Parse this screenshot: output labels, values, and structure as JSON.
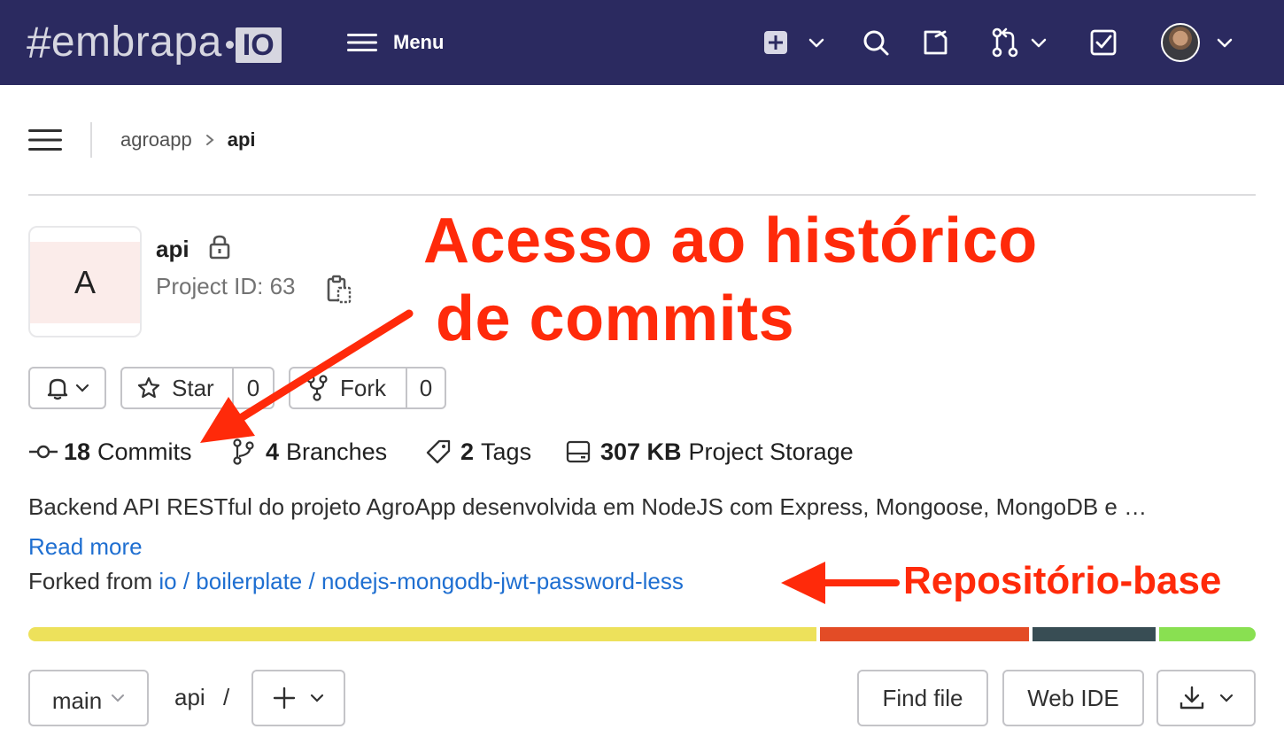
{
  "topbar": {
    "logo_hash": "#",
    "logo_word": "embrapa",
    "logo_io": "IO",
    "menu_label": "Menu",
    "bg_color": "#2b2a60"
  },
  "breadcrumb": {
    "group": "agroapp",
    "project": "api"
  },
  "project": {
    "avatar_letter": "A",
    "name": "api",
    "id_text": "Project ID: 63"
  },
  "actions": {
    "star_label": "Star",
    "star_count": "0",
    "fork_label": "Fork",
    "fork_count": "0"
  },
  "stats": {
    "commits_count": "18",
    "commits_label": "Commits",
    "branches_count": "4",
    "branches_label": "Branches",
    "tags_count": "2",
    "tags_label": "Tags",
    "storage_size": "307 KB",
    "storage_label": "Project Storage"
  },
  "description": "Backend API RESTful do projeto AgroApp desenvolvida em NodeJS com Express, Mongoose, MongoDB e …",
  "read_more": "Read more",
  "forked": {
    "prefix": "Forked from",
    "link": "io / boilerplate / nodejs-mongodb-jwt-password-less"
  },
  "languages": [
    {
      "color": "#ede15b",
      "fraction": 0.648
    },
    {
      "color": "#e34c26",
      "fraction": 0.172
    },
    {
      "color": "#384d54",
      "fraction": 0.101
    },
    {
      "color": "#89e051",
      "fraction": 0.073
    }
  ],
  "toolbar": {
    "branch": "main",
    "path_root": "api",
    "path_sep": "/",
    "find_file": "Find file",
    "web_ide": "Web IDE"
  },
  "annotations": {
    "commits_line1": "Acesso ao histórico",
    "commits_line2": "de commits",
    "fork_note": "Repositório-base",
    "color": "#ff2a0a"
  }
}
